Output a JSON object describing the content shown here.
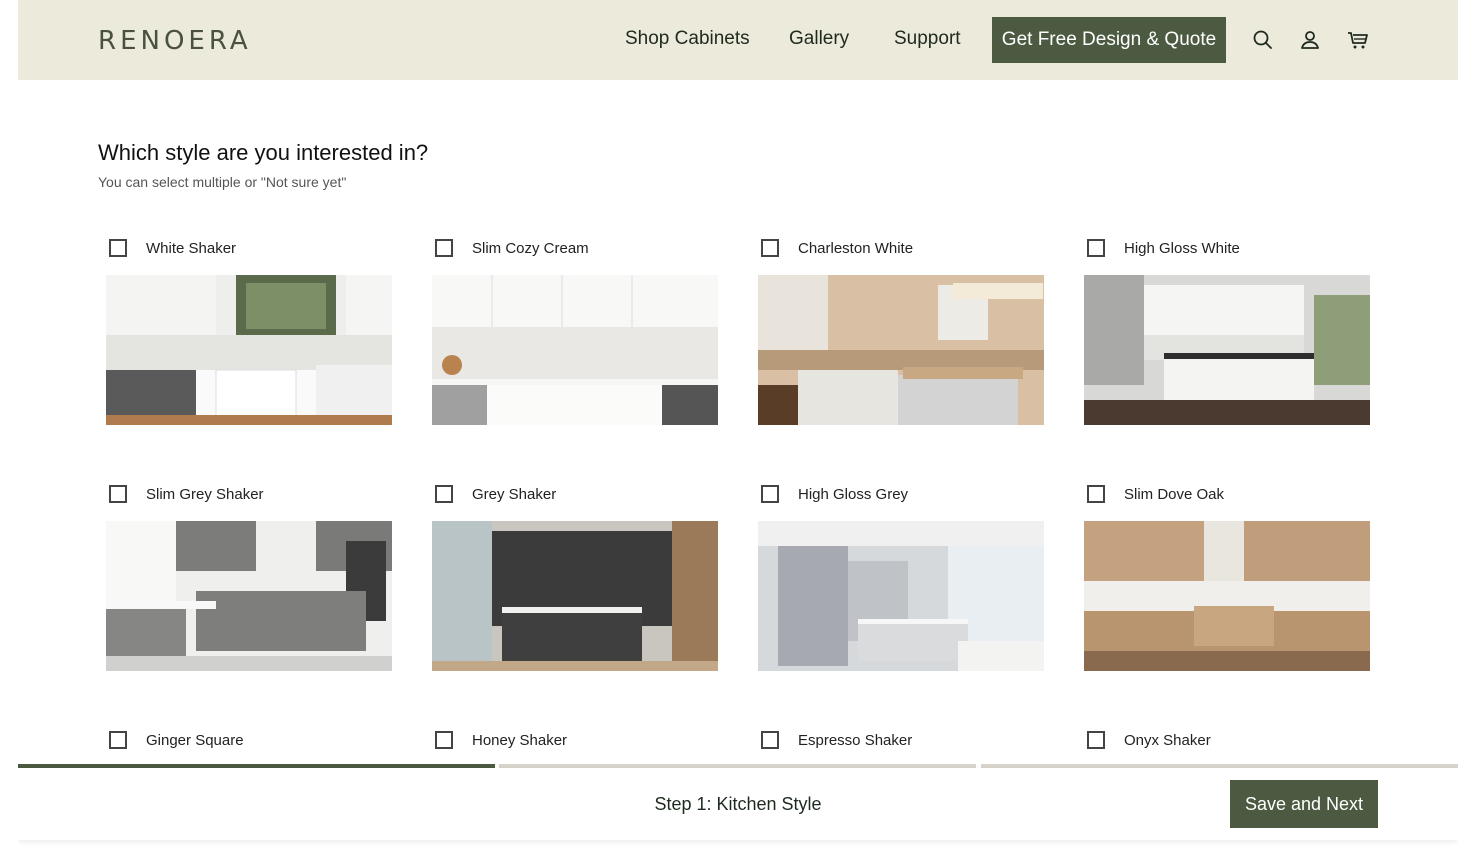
{
  "header": {
    "logo": "RENOERA",
    "nav": [
      "Shop Cabinets",
      "Gallery",
      "Support"
    ],
    "cta": "Get Free Design & Quote",
    "icons": [
      "search-icon",
      "user-icon",
      "cart-icon"
    ]
  },
  "question": {
    "title": "Which style are you interested in?",
    "subtitle": "You can select multiple or \"Not sure yet\""
  },
  "styles": [
    {
      "label": "White Shaker",
      "checked": false
    },
    {
      "label": "Slim Cozy Cream",
      "checked": false
    },
    {
      "label": "Charleston White",
      "checked": false
    },
    {
      "label": "High Gloss White",
      "checked": false
    },
    {
      "label": "Slim Grey Shaker",
      "checked": false
    },
    {
      "label": "Grey Shaker",
      "checked": false
    },
    {
      "label": "High Gloss Grey",
      "checked": false
    },
    {
      "label": "Slim Dove Oak",
      "checked": false
    },
    {
      "label": "Ginger Square",
      "checked": false
    },
    {
      "label": "Honey Shaker",
      "checked": false
    },
    {
      "label": "Espresso Shaker",
      "checked": false
    },
    {
      "label": "Onyx Shaker",
      "checked": false
    }
  ],
  "footer": {
    "step": "Step 1: Kitchen Style",
    "next": "Save and Next",
    "progress_steps_total": 3,
    "progress_current": 1
  },
  "colors": {
    "header_bg": "#ebeadb",
    "accent": "#4b5a40",
    "progress_inactive": "#d8d4cc"
  }
}
